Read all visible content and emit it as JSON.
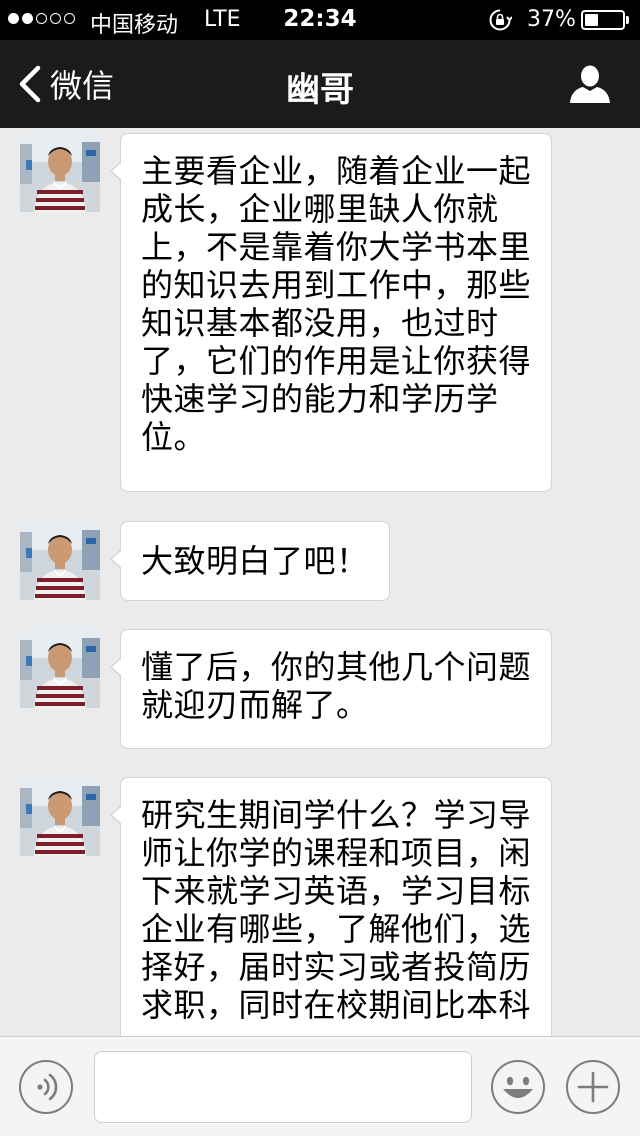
{
  "status_bar": {
    "carrier": "中国移动",
    "network": "LTE",
    "time": "22:34",
    "battery_text": "37%",
    "battery_level": 0.37,
    "signal_full": 2,
    "signal_total": 5,
    "icons": [
      "rotation-lock-icon",
      "battery-icon"
    ]
  },
  "nav": {
    "back_label": "微信",
    "title": "幽哥",
    "icons": [
      "chevron-left-icon",
      "profile-icon"
    ]
  },
  "messages": [
    {
      "sender": "幽哥",
      "text": "主要看企业，随着企业一起成长，企业哪里缺人你就上，不是靠着你大学书本里的知识去用到工作中，那些知识基本都没用，也过时了，它们的作用是让你获得快速学习的能力和学历学位。"
    },
    {
      "sender": "幽哥",
      "text": "大致明白了吧！"
    },
    {
      "sender": "幽哥",
      "text": "懂了后，你的其他几个问题就迎刃而解了。"
    },
    {
      "sender": "幽哥",
      "text": "研究生期间学什么？学习导师让你学的课程和项目，闲下来就学习英语，学习目标企业有哪些，了解他们，选择好，届时实习或者投简历求职，同时在校期间比本科"
    }
  ],
  "input_bar": {
    "value": "",
    "icons": [
      "voice-icon",
      "emoji-icon",
      "plus-icon"
    ]
  },
  "colors": {
    "status_bar_bg": "#000000",
    "nav_bg": "#1b1b1e",
    "chat_bg": "#ebebeb",
    "bubble_bg": "#ffffff",
    "input_bar_bg": "#f4f4f6"
  }
}
